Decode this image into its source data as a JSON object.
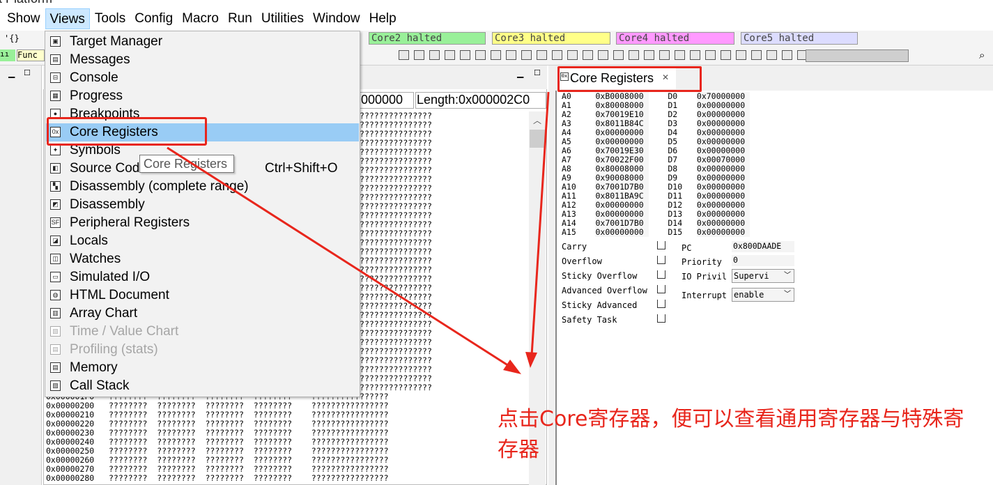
{
  "title": "t Platform",
  "menubar": [
    "Show",
    "Views",
    "Tools",
    "Config",
    "Macro",
    "Run",
    "Utilities",
    "Window",
    "Help"
  ],
  "active_menu": "Views",
  "toolbar": {
    "left_snippets": [
      "'{}",
      "Func"
    ],
    "core_status": [
      {
        "label": "Core2 halted",
        "color": "#99f099"
      },
      {
        "label": "Core3 halted",
        "color": "#ffff88"
      },
      {
        "label": "Core4 halted",
        "color": "#ff99ff"
      },
      {
        "label": "Core5 halted",
        "color": "#dcdcff"
      }
    ]
  },
  "views_menu": [
    {
      "label": "Target Manager",
      "icon": "target-manager-icon",
      "enabled": true
    },
    {
      "label": "Messages",
      "icon": "messages-icon",
      "enabled": true
    },
    {
      "label": "Console",
      "icon": "console-icon",
      "enabled": true
    },
    {
      "label": "Progress",
      "icon": "progress-icon",
      "enabled": true
    },
    {
      "label": "Breakpoints",
      "icon": "breakpoints-icon",
      "enabled": true
    },
    {
      "label": "Core Registers",
      "icon": "core-registers-icon",
      "enabled": true,
      "highlighted": true
    },
    {
      "label": "Symbols",
      "icon": "symbols-icon",
      "enabled": true
    },
    {
      "label": "Source Code",
      "icon": "source-code-icon",
      "enabled": true,
      "shortcut": "Ctrl+Shift+O"
    },
    {
      "label": "Disassembly (complete range)",
      "icon": "disassembly-range-icon",
      "enabled": true
    },
    {
      "label": "Disassembly",
      "icon": "disassembly-icon",
      "enabled": true
    },
    {
      "label": "Peripheral Registers",
      "icon": "peripheral-registers-icon",
      "enabled": true
    },
    {
      "label": "Locals",
      "icon": "locals-icon",
      "enabled": true
    },
    {
      "label": "Watches",
      "icon": "watches-icon",
      "enabled": true
    },
    {
      "label": "Simulated I/O",
      "icon": "simulated-io-icon",
      "enabled": true
    },
    {
      "label": "HTML Document",
      "icon": "html-document-icon",
      "enabled": true
    },
    {
      "label": "Array Chart",
      "icon": "array-chart-icon",
      "enabled": true
    },
    {
      "label": "Time / Value Chart",
      "icon": "time-value-chart-icon",
      "enabled": false
    },
    {
      "label": "Profiling (stats)",
      "icon": "profiling-icon",
      "enabled": false
    },
    {
      "label": "Memory",
      "icon": "memory-icon",
      "enabled": true
    },
    {
      "label": "Call Stack",
      "icon": "call-stack-icon",
      "enabled": true
    }
  ],
  "tooltip": "Core Registers",
  "memory": {
    "address_field": "000000",
    "length_field": "Length:0x000002C0",
    "unknown_long": "????????????????",
    "unknown_word": "????????",
    "rows": [
      "0x000001F0",
      "0x00000200",
      "0x00000210",
      "0x00000220",
      "0x00000230",
      "0x00000240",
      "0x00000250",
      "0x00000260",
      "0x00000270",
      "0x00000280"
    ]
  },
  "core_registers_tab": "Core Registers",
  "registers": {
    "A": [
      [
        "A0",
        "0xB0008000"
      ],
      [
        "A1",
        "0x80008000"
      ],
      [
        "A2",
        "0x70019E10"
      ],
      [
        "A3",
        "0x8011B84C"
      ],
      [
        "A4",
        "0x00000000"
      ],
      [
        "A5",
        "0x00000000"
      ],
      [
        "A6",
        "0x70019E30"
      ],
      [
        "A7",
        "0x70022F00"
      ],
      [
        "A8",
        "0x80008000"
      ],
      [
        "A9",
        "0x90008000"
      ],
      [
        "A10",
        "0x7001D7B0"
      ],
      [
        "A11",
        "0x8011BA9C"
      ],
      [
        "A12",
        "0x00000000"
      ],
      [
        "A13",
        "0x00000000"
      ],
      [
        "A14",
        "0x7001D7B0"
      ],
      [
        "A15",
        "0x00000000"
      ]
    ],
    "D": [
      [
        "D0",
        "0x70000000"
      ],
      [
        "D1",
        "0x00000000"
      ],
      [
        "D2",
        "0x00000000"
      ],
      [
        "D3",
        "0x00000000"
      ],
      [
        "D4",
        "0x00000000"
      ],
      [
        "D5",
        "0x00000000"
      ],
      [
        "D6",
        "0x00000000"
      ],
      [
        "D7",
        "0x00070000"
      ],
      [
        "D8",
        "0x00000000"
      ],
      [
        "D9",
        "0x00000000"
      ],
      [
        "D10",
        "0x00000000"
      ],
      [
        "D11",
        "0x00000000"
      ],
      [
        "D12",
        "0x00000000"
      ],
      [
        "D13",
        "0x00000000"
      ],
      [
        "D14",
        "0x00000000"
      ],
      [
        "D15",
        "0x00000000"
      ]
    ]
  },
  "flags": [
    "Carry",
    "Overflow",
    "Sticky Overflow",
    "Advanced Overflow",
    "Sticky Advanced",
    "Safety Task"
  ],
  "special": {
    "pc_label": "PC",
    "pc_value": "0x800DAADE",
    "priority_label": "Priority",
    "priority_value": "0",
    "io_label": "IO Privil",
    "io_value": "Supervi",
    "interrupt_label": "Interrupt",
    "interrupt_value": "enable"
  },
  "annotation": "点击Core寄存器，便可以查看通用寄存器与特殊寄存器",
  "colors": {
    "highlight": "#99ccf5",
    "annotation": "#e8261c"
  }
}
